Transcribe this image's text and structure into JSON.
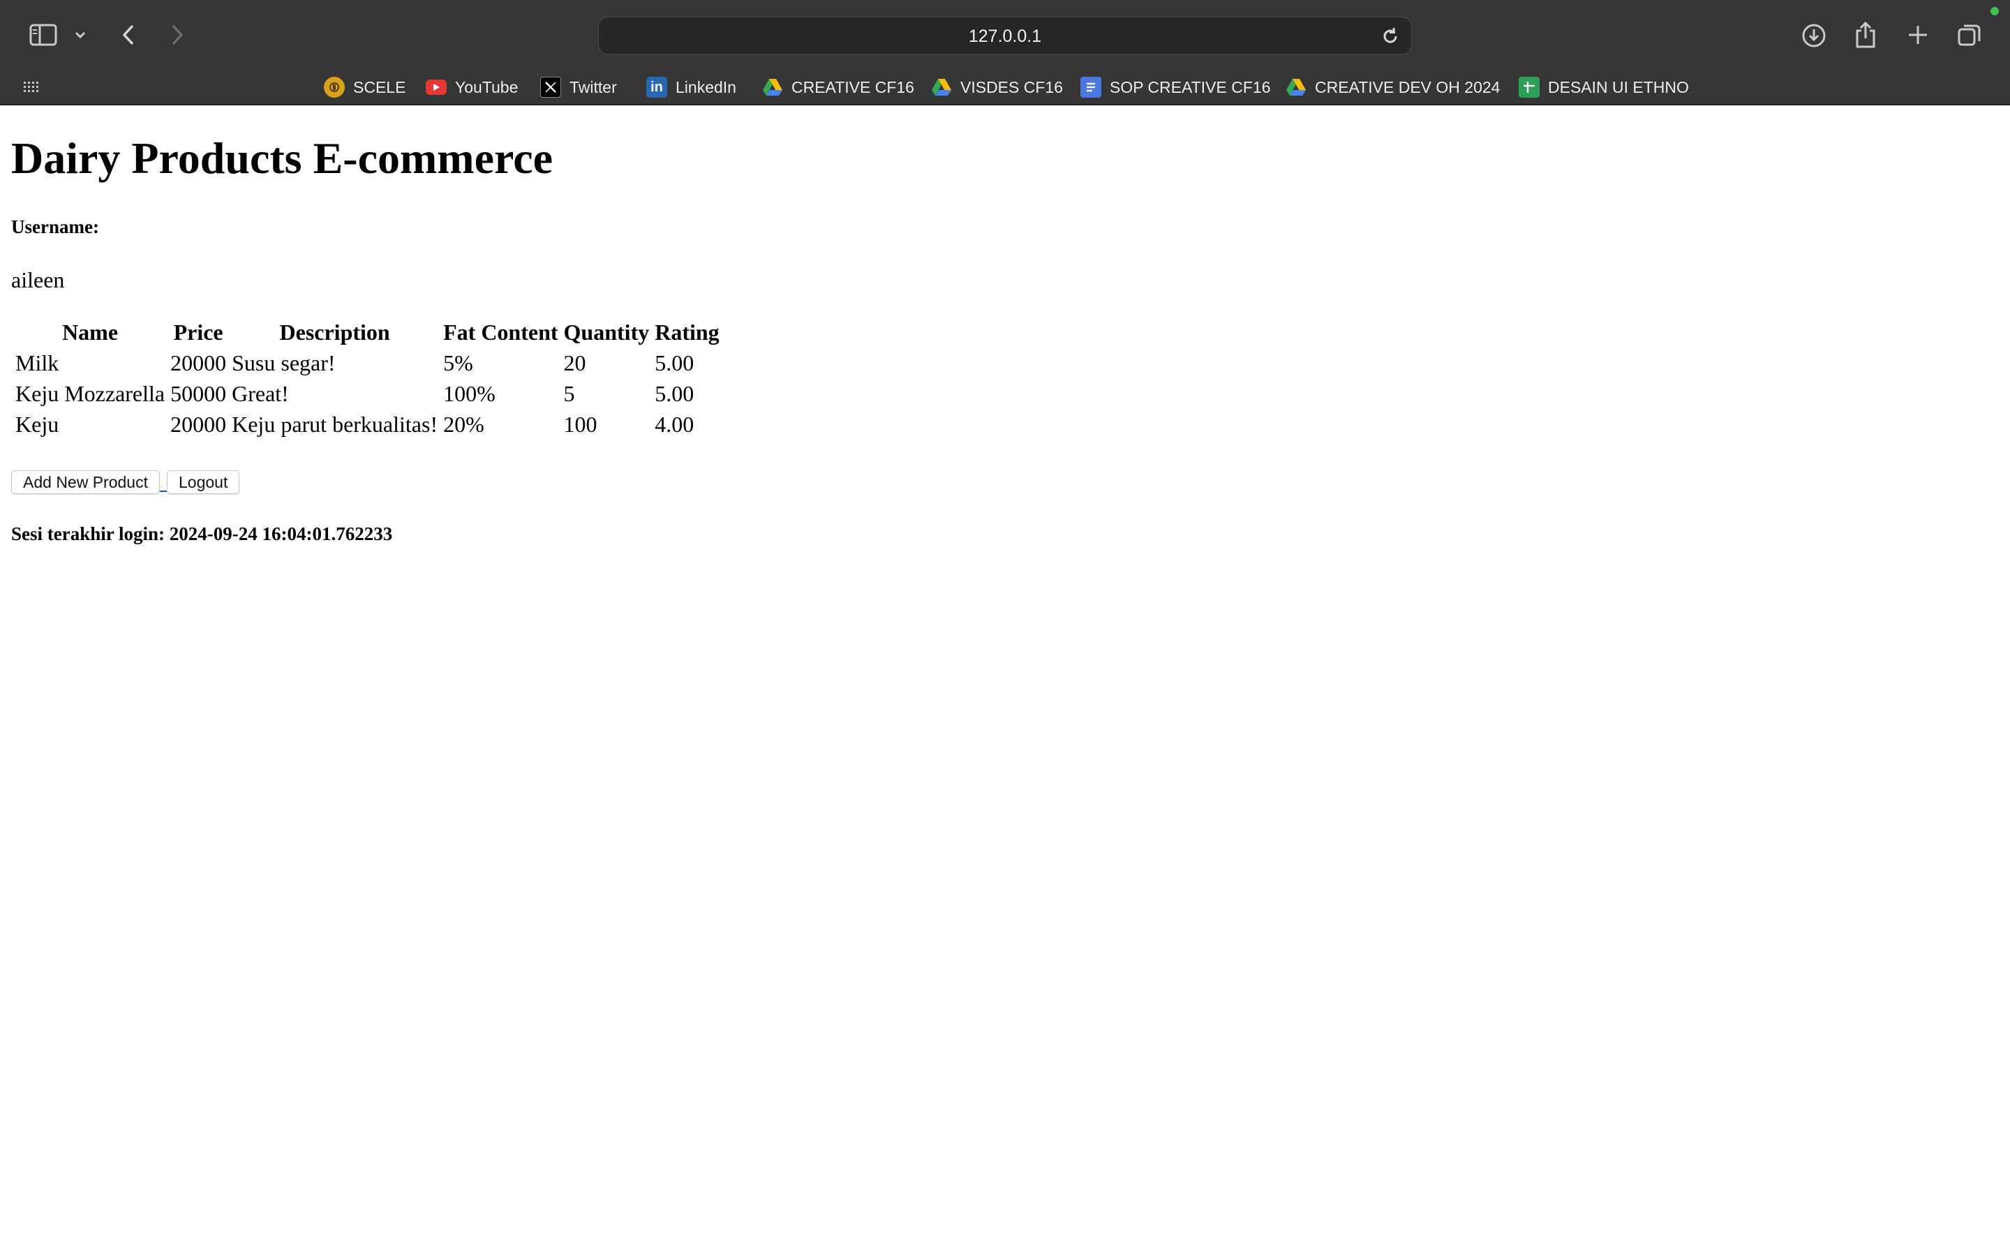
{
  "browser": {
    "url": "127.0.0.1",
    "bookmarks": [
      {
        "label": "SCELE",
        "icon": "scele-icon",
        "color": "#d9a21b"
      },
      {
        "label": "YouTube",
        "icon": "youtube-icon",
        "color": "#e53935"
      },
      {
        "label": "Twitter",
        "icon": "x-twitter-icon",
        "color": "#000000"
      },
      {
        "label": "LinkedIn",
        "icon": "linkedin-icon",
        "color": "#2867b2"
      },
      {
        "label": "CREATIVE CF16",
        "icon": "google-drive-icon",
        "color": "#34a853"
      },
      {
        "label": "VISDES CF16",
        "icon": "google-drive-icon",
        "color": "#34a853"
      },
      {
        "label": "SOP CREATIVE CF16",
        "icon": "google-docs-icon",
        "color": "#4a78e0"
      },
      {
        "label": "CREATIVE DEV OH 2024",
        "icon": "google-drive-icon",
        "color": "#34a853"
      },
      {
        "label": "DESAIN UI ETHNO",
        "icon": "google-sheets-icon",
        "color": "#2e9e58"
      }
    ]
  },
  "page": {
    "title": "Dairy Products E-commerce",
    "username_label": "Username:",
    "username": "aileen",
    "table": {
      "headers": [
        "Name",
        "Price",
        "Description",
        "Fat Content",
        "Quantity",
        "Rating"
      ],
      "rows": [
        [
          "Milk",
          "20000",
          "Susu segar!",
          "5%",
          "20",
          "5.00"
        ],
        [
          "Keju Mozzarella",
          "50000",
          "Great!",
          "100%",
          "5",
          "5.00"
        ],
        [
          "Keju",
          "20000",
          "Keju parut berkualitas!",
          "20%",
          "100",
          "4.00"
        ]
      ]
    },
    "buttons": {
      "add_product": "Add New Product",
      "logout": "Logout"
    },
    "last_login": "Sesi terakhir login: 2024-09-24 16:04:01.762233"
  }
}
